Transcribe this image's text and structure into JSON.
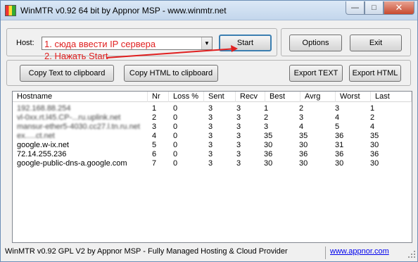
{
  "window": {
    "title": "WinMTR v0.92 64 bit by Appnor MSP - www.winmtr.net"
  },
  "host": {
    "label": "Host:",
    "value": "1. сюда ввести IP сервера",
    "hint": "2. Нажать Start"
  },
  "buttons": {
    "start": "Start",
    "options": "Options",
    "exit": "Exit",
    "copy_text": "Copy Text to clipboard",
    "copy_html": "Copy HTML to clipboard",
    "export_text": "Export TEXT",
    "export_html": "Export HTML"
  },
  "table": {
    "columns": [
      "Hostname",
      "Nr",
      "Loss %",
      "Sent",
      "Recv",
      "Best",
      "Avrg",
      "Worst",
      "Last"
    ],
    "rows": [
      {
        "host": "192.168.88.254",
        "nr": "1",
        "loss": "0",
        "sent": "3",
        "recv": "3",
        "best": "1",
        "avrg": "2",
        "worst": "3",
        "last": "1"
      },
      {
        "host": "vl-0xx.rt.l45.CP-...ru.uplink.net",
        "nr": "2",
        "loss": "0",
        "sent": "3",
        "recv": "3",
        "best": "2",
        "avrg": "3",
        "worst": "4",
        "last": "2"
      },
      {
        "host": "mansur-ether5-4030.cc27.l.tn.ru.net",
        "nr": "3",
        "loss": "0",
        "sent": "3",
        "recv": "3",
        "best": "3",
        "avrg": "4",
        "worst": "5",
        "last": "4"
      },
      {
        "host": "ex.....ct.net",
        "nr": "4",
        "loss": "0",
        "sent": "3",
        "recv": "3",
        "best": "35",
        "avrg": "35",
        "worst": "36",
        "last": "35"
      },
      {
        "host": "google.w-ix.net",
        "nr": "5",
        "loss": "0",
        "sent": "3",
        "recv": "3",
        "best": "30",
        "avrg": "30",
        "worst": "31",
        "last": "30"
      },
      {
        "host": "72.14.255.236",
        "nr": "6",
        "loss": "0",
        "sent": "3",
        "recv": "3",
        "best": "36",
        "avrg": "36",
        "worst": "36",
        "last": "36"
      },
      {
        "host": "google-public-dns-a.google.com",
        "nr": "7",
        "loss": "0",
        "sent": "3",
        "recv": "3",
        "best": "30",
        "avrg": "30",
        "worst": "30",
        "last": "30"
      }
    ]
  },
  "status": {
    "text": "WinMTR v0.92 GPL V2 by Appnor MSP - Fully Managed Hosting & Cloud Provider",
    "link": "www.appnor.com"
  },
  "colors": {
    "annotation": "#e02020",
    "link": "#0000ee",
    "titlebar": "#c3d6ec"
  },
  "icons": [
    "app-icon",
    "minimize-icon",
    "maximize-icon",
    "close-icon",
    "dropdown-arrow-icon",
    "resize-grip-icon"
  ]
}
